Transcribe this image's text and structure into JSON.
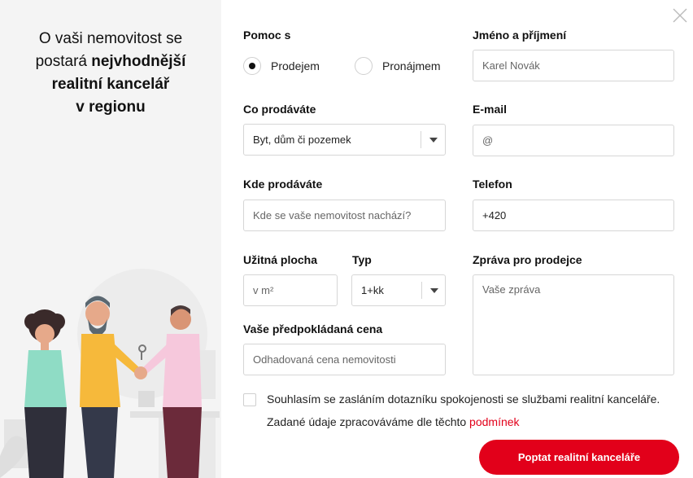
{
  "colors": {
    "accent": "#e2001a",
    "left_bg": "#f4f4f4"
  },
  "headline": {
    "line1": "O vaši nemovitost se",
    "line2_normal": "postará ",
    "line2_bold": "nejvhodnější",
    "line3": "realitní kancelář",
    "line4": "v regionu"
  },
  "form": {
    "help_label": "Pomoc s",
    "radio_sale": "Prodejem",
    "radio_rent": "Pronájmem",
    "selected": "Prodejem",
    "what_label": "Co prodáváte",
    "what_value": "Byt, dům či pozemek",
    "where_label": "Kde prodáváte",
    "where_placeholder": "Kde se vaše nemovitost nachází?",
    "area_label": "Užitná plocha",
    "area_placeholder": "v m²",
    "type_label": "Typ",
    "type_value": "1+kk",
    "price_label": "Vaše předpokládaná cena",
    "price_placeholder": "Odhadovaná cena nemovitosti",
    "name_label": "Jméno a příjmení",
    "name_placeholder": "Karel Novák",
    "email_label": "E-mail",
    "email_placeholder": "@",
    "phone_label": "Telefon",
    "phone_value": "+420",
    "message_label": "Zpráva pro prodejce",
    "message_placeholder": "Vaše zpráva",
    "consent_text": "Souhlasím se zasláním dotazníku spokojenosti se službami realitní kanceláře.",
    "data_text": "Zadané údaje zpracováváme dle těchto ",
    "data_link": "podmínek",
    "submit_label": "Poptat realitní kanceláře"
  },
  "icons": {
    "close": "close-icon",
    "dropdown": "chevron-down-icon"
  }
}
